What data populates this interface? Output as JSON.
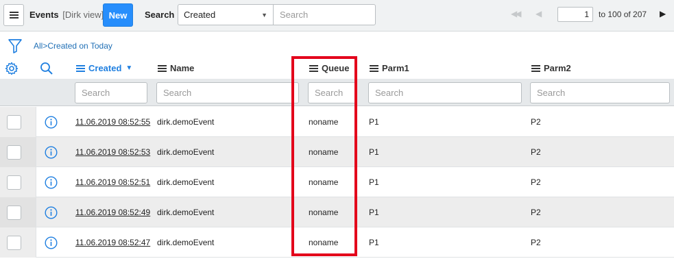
{
  "header": {
    "title": "Events",
    "view": "[Dirk view]",
    "new_label": "New",
    "search_label": "Search",
    "search_field_selected": "Created",
    "search_placeholder": "Search",
    "page_current": "1",
    "page_range": "to 100 of 207"
  },
  "breadcrumb": {
    "all": "All",
    "separator": ">",
    "filter": "Created on Today"
  },
  "columns": {
    "created": "Created",
    "name": "Name",
    "queue": "Queue",
    "parm1": "Parm1",
    "parm2": "Parm2"
  },
  "filters": {
    "created": "Search",
    "name": "Search",
    "queue": "Search",
    "parm1": "Search",
    "parm2": "Search"
  },
  "rows": [
    {
      "created": "11.06.2019 08:52:55",
      "name": "dirk.demoEvent",
      "queue": "noname",
      "parm1": "P1",
      "parm2": "P2"
    },
    {
      "created": "11.06.2019 08:52:53",
      "name": "dirk.demoEvent",
      "queue": "noname",
      "parm1": "P1",
      "parm2": "P2"
    },
    {
      "created": "11.06.2019 08:52:51",
      "name": "dirk.demoEvent",
      "queue": "noname",
      "parm1": "P1",
      "parm2": "P2"
    },
    {
      "created": "11.06.2019 08:52:49",
      "name": "dirk.demoEvent",
      "queue": "noname",
      "parm1": "P1",
      "parm2": "P2"
    },
    {
      "created": "11.06.2019 08:52:47",
      "name": "dirk.demoEvent",
      "queue": "noname",
      "parm1": "P1",
      "parm2": "P2"
    }
  ],
  "colors": {
    "accent": "#278efc",
    "link": "#1f6fb5",
    "highlight": "#e3001b"
  },
  "icons": {
    "menu": "hamburger-icon",
    "filter": "funnel-icon",
    "settings": "gear-icon",
    "search": "magnifier-icon",
    "info": "info-circle-icon"
  }
}
